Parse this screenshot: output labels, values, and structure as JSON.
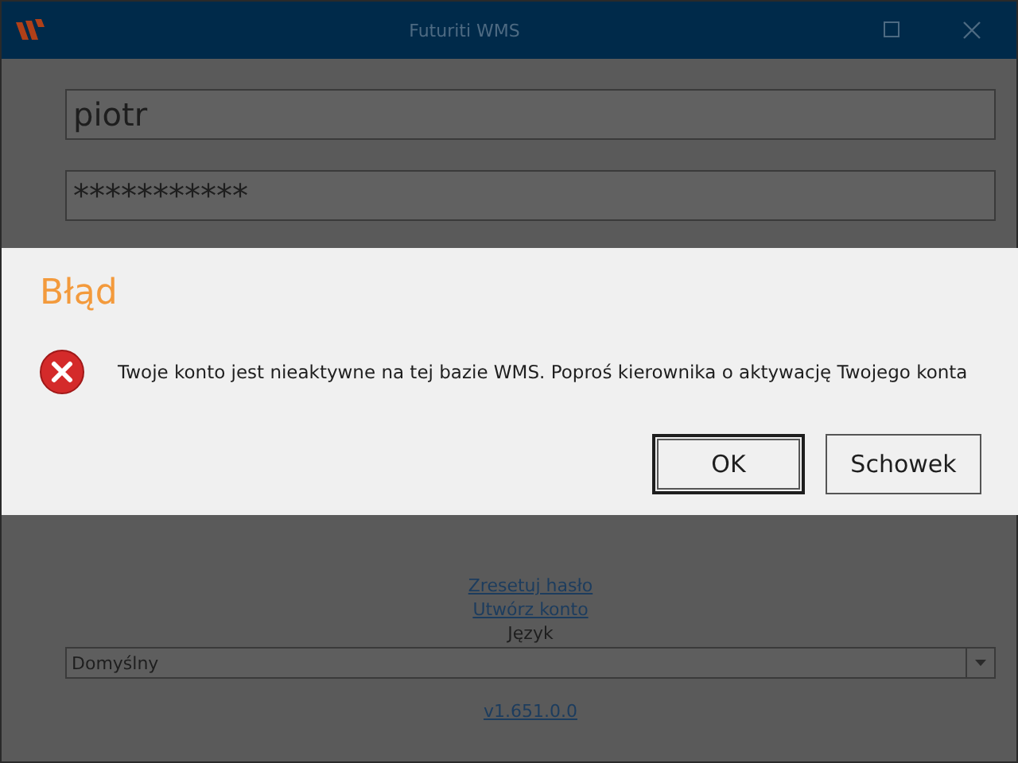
{
  "window": {
    "title": "Futuriti WMS"
  },
  "login": {
    "username": "piotr",
    "password": "***********"
  },
  "links": [
    "Zresetuj hasło",
    "Utwórz konto"
  ],
  "language": {
    "label": "Język",
    "value": "Domyślny"
  },
  "version": "v1.651.0.0",
  "dialog": {
    "title": "Błąd",
    "message": "Twoje konto jest nieaktywne na tej bazie WMS. Poproś kierownika o aktywację Twojego konta",
    "buttons": [
      {
        "label": "OK",
        "selected": true
      },
      {
        "label": "Schowek",
        "selected": false
      }
    ]
  }
}
